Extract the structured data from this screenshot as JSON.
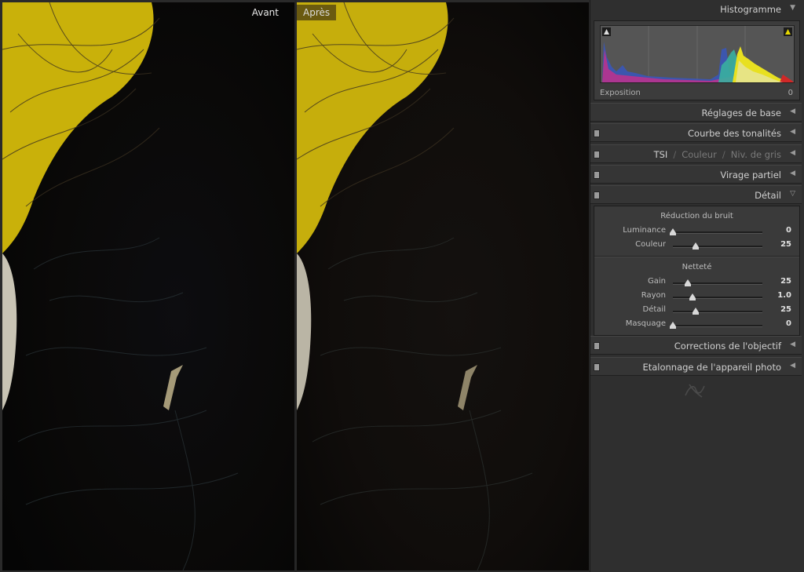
{
  "photos": {
    "before_label": "Avant",
    "after_label": "Après"
  },
  "histogram": {
    "title": "Histogramme",
    "exposure_label": "Exposition",
    "exposure_value": "0"
  },
  "panels": {
    "basic": "Réglages de base",
    "tone_curve": "Courbe des tonalités",
    "tsi": "TSI",
    "color": "Couleur",
    "grayscale": "Niv. de gris",
    "split_toning": "Virage partiel",
    "detail": "Détail",
    "lens": "Corrections de l'objectif",
    "calibration": "Etalonnage de l'appareil photo"
  },
  "detail": {
    "noise_title": "Réduction du bruit",
    "luminance": {
      "label": "Luminance",
      "value": "0",
      "pos": 0.0
    },
    "color": {
      "label": "Couleur",
      "value": "25",
      "pos": 0.25
    },
    "sharpening_title": "Netteté",
    "gain": {
      "label": "Gain",
      "value": "25",
      "pos": 0.17
    },
    "radius": {
      "label": "Rayon",
      "value": "1.0",
      "pos": 0.22
    },
    "detail": {
      "label": "Détail",
      "value": "25",
      "pos": 0.25
    },
    "masking": {
      "label": "Masquage",
      "value": "0",
      "pos": 0.0
    }
  }
}
